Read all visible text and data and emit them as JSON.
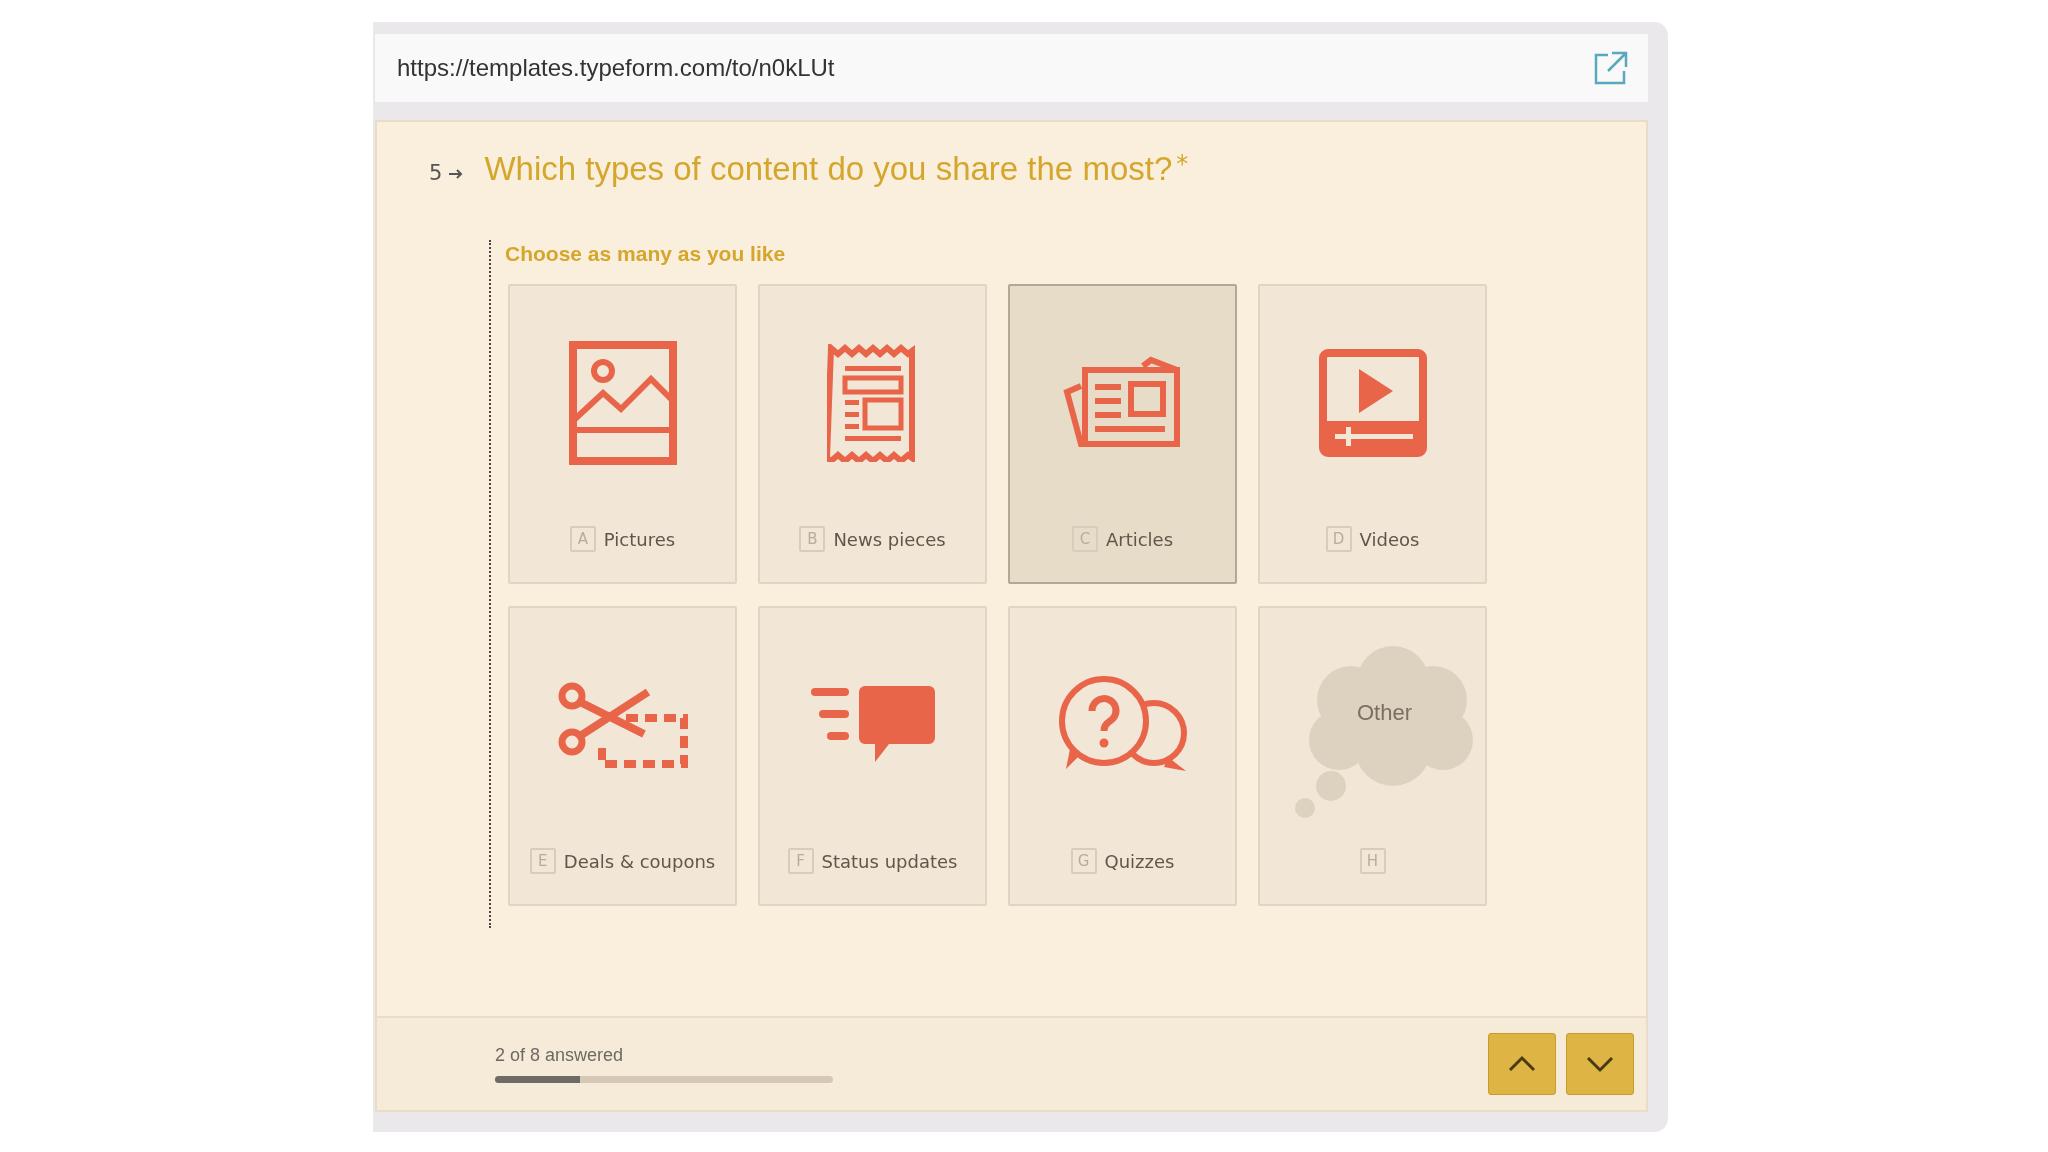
{
  "address_bar": {
    "url": "https://templates.typeform.com/to/n0kLUt"
  },
  "question": {
    "number": "5",
    "title": "Which types of content do you share the most?",
    "required_mark": "*",
    "hint": "Choose as many as you like"
  },
  "choices": [
    {
      "key": "A",
      "label": "Pictures",
      "kind": "picture",
      "selected": false
    },
    {
      "key": "B",
      "label": "News pieces",
      "kind": "news",
      "selected": false
    },
    {
      "key": "C",
      "label": "Articles",
      "kind": "articles",
      "selected": true
    },
    {
      "key": "D",
      "label": "Videos",
      "kind": "video",
      "selected": false
    },
    {
      "key": "E",
      "label": "Deals & coupons",
      "kind": "coupon",
      "selected": false
    },
    {
      "key": "F",
      "label": "Status updates",
      "kind": "status",
      "selected": false
    },
    {
      "key": "G",
      "label": "Quizzes",
      "kind": "quiz",
      "selected": false
    },
    {
      "key": "H",
      "label": "Other",
      "kind": "other",
      "selected": false
    }
  ],
  "footer": {
    "progress_text": "2 of 8 answered",
    "level": 0.25
  }
}
